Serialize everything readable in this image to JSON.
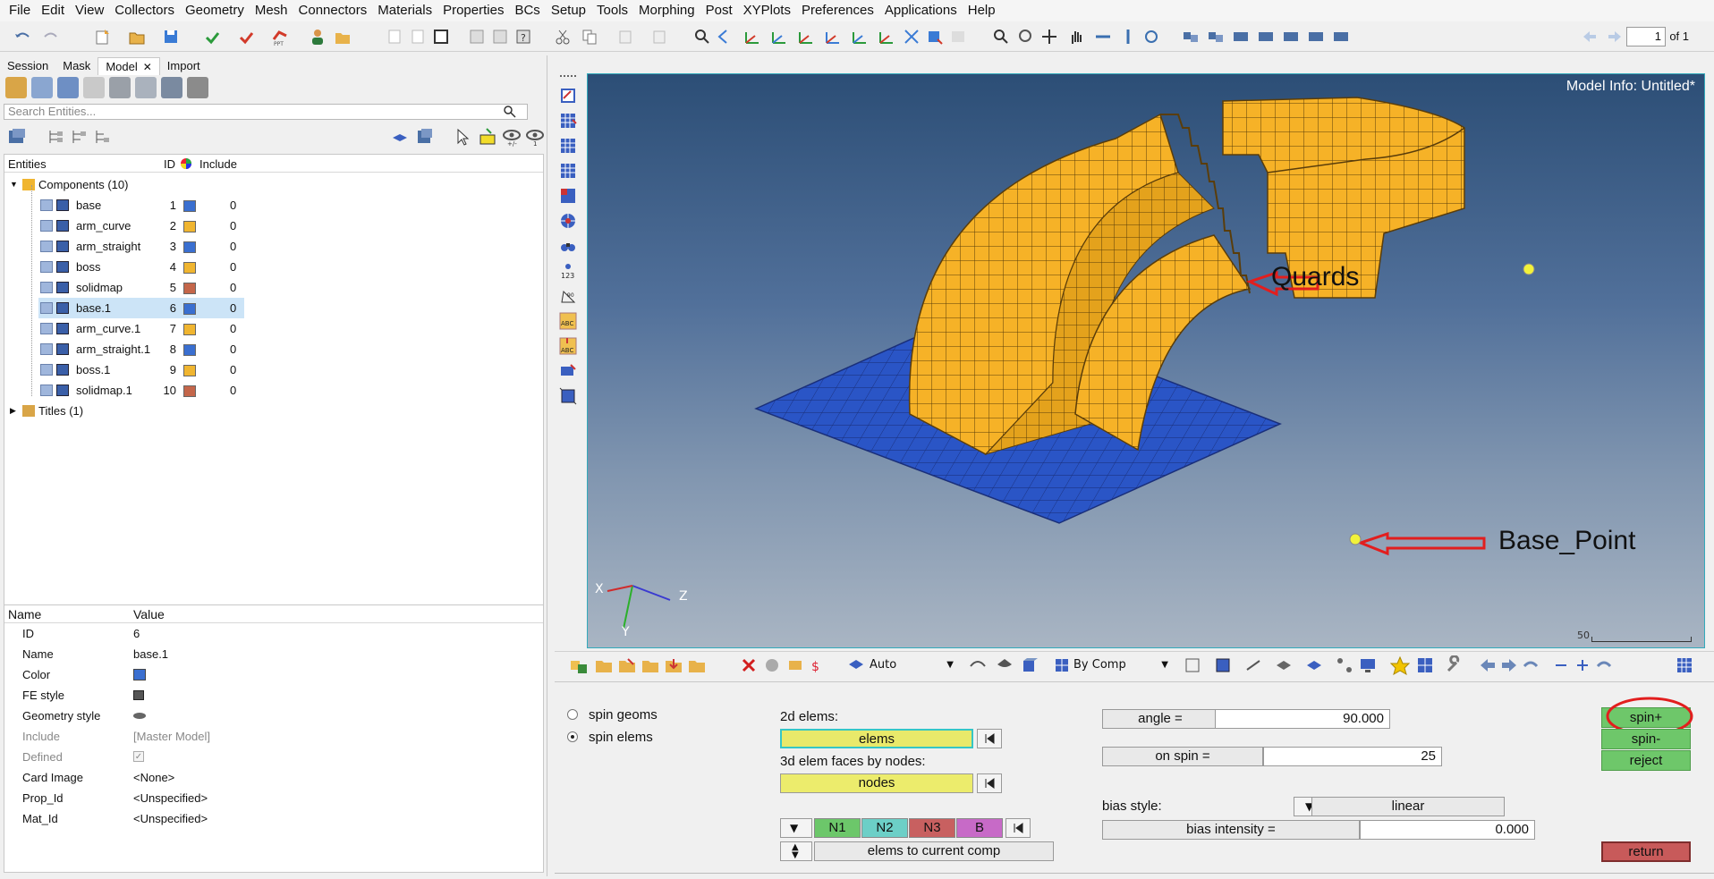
{
  "menu": [
    "File",
    "Edit",
    "View",
    "Collectors",
    "Geometry",
    "Mesh",
    "Connectors",
    "Materials",
    "Properties",
    "BCs",
    "Setup",
    "Tools",
    "Morphing",
    "Post",
    "XYPlots",
    "Preferences",
    "Applications",
    "Help"
  ],
  "toolbar": {
    "page_value": "1",
    "page_of": "of 1"
  },
  "tabs": [
    {
      "label": "Session",
      "active": false
    },
    {
      "label": "Mask",
      "active": false
    },
    {
      "label": "Model",
      "active": true
    },
    {
      "label": "Import",
      "active": false
    }
  ],
  "search": {
    "placeholder": "Search Entities..."
  },
  "tree": {
    "headers": {
      "entities": "Entities",
      "id": "ID",
      "include": "Include"
    },
    "components_label": "Components (10)",
    "titles_label": "Titles (1)",
    "rows": [
      {
        "name": "base",
        "id": "1",
        "color": "#3a6fd0",
        "include": "0",
        "selected": false
      },
      {
        "name": "arm_curve",
        "id": "2",
        "color": "#f0b530",
        "include": "0",
        "selected": false
      },
      {
        "name": "arm_straight",
        "id": "3",
        "color": "#3a6fd0",
        "include": "0",
        "selected": false
      },
      {
        "name": "boss",
        "id": "4",
        "color": "#f0b530",
        "include": "0",
        "selected": false
      },
      {
        "name": "solidmap",
        "id": "5",
        "color": "#c4664a",
        "include": "0",
        "selected": false
      },
      {
        "name": "base.1",
        "id": "6",
        "color": "#3a6fd0",
        "include": "0",
        "selected": true
      },
      {
        "name": "arm_curve.1",
        "id": "7",
        "color": "#f0b530",
        "include": "0",
        "selected": false
      },
      {
        "name": "arm_straight.1",
        "id": "8",
        "color": "#3a6fd0",
        "include": "0",
        "selected": false
      },
      {
        "name": "boss.1",
        "id": "9",
        "color": "#f0b530",
        "include": "0",
        "selected": false
      },
      {
        "name": "solidmap.1",
        "id": "10",
        "color": "#c4664a",
        "include": "0",
        "selected": false
      }
    ]
  },
  "props": {
    "headers": {
      "name": "Name",
      "value": "Value"
    },
    "rows": [
      {
        "name": "ID",
        "value": "6",
        "grey": false
      },
      {
        "name": "Name",
        "value": "base.1",
        "grey": false
      },
      {
        "name": "Color",
        "value": "",
        "grey": false
      },
      {
        "name": "FE style",
        "value": "",
        "grey": false
      },
      {
        "name": "Geometry style",
        "value": "",
        "grey": false
      },
      {
        "name": "Include",
        "value": "[Master Model]",
        "grey": true
      },
      {
        "name": "Defined",
        "value": "",
        "grey": true
      },
      {
        "name": "Card Image",
        "value": "<None>",
        "grey": false
      },
      {
        "name": "Prop_Id",
        "value": "<Unspecified>",
        "grey": false
      },
      {
        "name": "Mat_Id",
        "value": "<Unspecified>",
        "grey": false
      }
    ]
  },
  "viewport": {
    "model_info": "Model Info: Untitled*",
    "annotation_quards": "Quards",
    "annotation_base_point": "Base_Point",
    "scale_label": "50",
    "axis_x": "X",
    "axis_y": "Y",
    "axis_z": "Z"
  },
  "bottom_toolbar": {
    "auto_label": "Auto",
    "bycomp_label": "By Comp"
  },
  "panel": {
    "radio_geoms": "spin geoms",
    "radio_elems": "spin elems",
    "elems2d_label": "2d elems:",
    "elems_btn": "elems",
    "faces_label": "3d elem faces by nodes:",
    "nodes_btn": "nodes",
    "n1": "N1",
    "n2": "N2",
    "n3": "N3",
    "b": "B",
    "elems_to_comp": "elems to current comp",
    "angle_label": "angle =",
    "angle_value": "90.000",
    "onspin_label": "on spin =",
    "onspin_value": "25",
    "bias_style_label": "bias style:",
    "bias_style_value": "linear",
    "bias_intensity_label": "bias intensity =",
    "bias_intensity_value": "0.000",
    "spin_plus": "spin+",
    "spin_minus": "spin-",
    "reject": "reject",
    "return": "return"
  }
}
